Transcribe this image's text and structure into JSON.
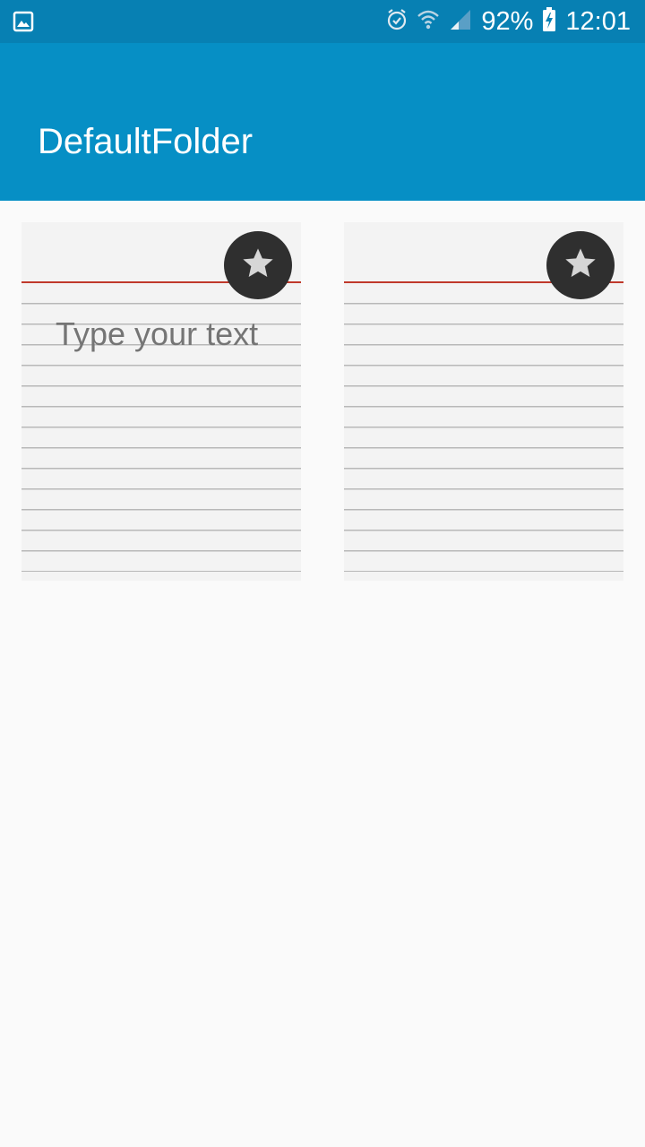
{
  "status_bar": {
    "battery": "92%",
    "time": "12:01",
    "icons": [
      "gallery-icon",
      "alarm-icon",
      "wifi-icon",
      "signal-icon",
      "battery-charging-icon"
    ]
  },
  "app_bar": {
    "title": "DefaultFolder"
  },
  "notes": [
    {
      "text": "Type your text",
      "favorite_icon": "star-icon"
    },
    {
      "text": "",
      "favorite_icon": "star-icon"
    }
  ],
  "colors": {
    "status_bar": "#0780b3",
    "app_bar": "#068fc5",
    "background": "#fafafa",
    "card": "#f3f3f3",
    "margin_line": "#c0392b",
    "fav_button": "#2f2f2f",
    "star": "#d6d6d6"
  }
}
